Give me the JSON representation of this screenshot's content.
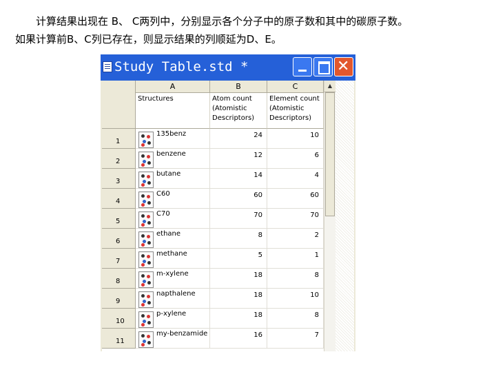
{
  "intro": {
    "line1": "计算结果出现在 B、 C两列中，分别显示各个分子中的原子数和其中的碳原子数。",
    "line2": "如果计算前B、C列已存在，则显示结果的列顺延为D、E。"
  },
  "window": {
    "title": "Study Table.std *",
    "minimize_icon": "minimize-icon",
    "maximize_icon": "maximize-icon",
    "close_icon": "close-icon"
  },
  "table": {
    "column_letters": [
      "A",
      "B",
      "C"
    ],
    "column_headers": [
      "Structures",
      "Atom count\n(Atomistic\nDescriptors)",
      "Element count\n(Atomistic\nDescriptors)"
    ],
    "rows": [
      {
        "index": "1",
        "name": "135benz",
        "atom_count": "24",
        "element_count": "10"
      },
      {
        "index": "2",
        "name": "benzene",
        "atom_count": "12",
        "element_count": "6"
      },
      {
        "index": "3",
        "name": "butane",
        "atom_count": "14",
        "element_count": "4"
      },
      {
        "index": "4",
        "name": "C60",
        "atom_count": "60",
        "element_count": "60"
      },
      {
        "index": "5",
        "name": "C70",
        "atom_count": "70",
        "element_count": "70"
      },
      {
        "index": "6",
        "name": "ethane",
        "atom_count": "8",
        "element_count": "2"
      },
      {
        "index": "7",
        "name": "methane",
        "atom_count": "5",
        "element_count": "1"
      },
      {
        "index": "8",
        "name": "m-xylene",
        "atom_count": "18",
        "element_count": "8"
      },
      {
        "index": "9",
        "name": "napthalene",
        "atom_count": "18",
        "element_count": "10"
      },
      {
        "index": "10",
        "name": "p-xylene",
        "atom_count": "18",
        "element_count": "8"
      },
      {
        "index": "11",
        "name": "my-benzamide",
        "atom_count": "16",
        "element_count": "7"
      }
    ]
  }
}
